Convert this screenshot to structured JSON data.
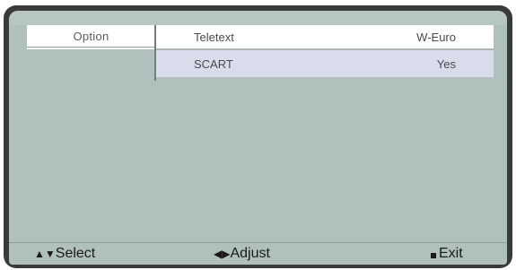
{
  "menu": {
    "category": "Option",
    "items": [
      {
        "label": "Teletext",
        "value": "W-Euro"
      },
      {
        "label": "SCART",
        "value": "Yes"
      }
    ]
  },
  "footer": {
    "select": {
      "icon": "up-down-arrows-icon",
      "glyph": "▲▼",
      "label": "Select"
    },
    "adjust": {
      "icon": "left-right-arrows-icon",
      "glyph": "◀▶",
      "label": "Adjust"
    },
    "exit": {
      "icon": "exit-square-icon",
      "label": "Exit"
    }
  },
  "colors": {
    "panel": "#b0c1bd",
    "row_normal": "#ffffff",
    "row_selected": "#d9dcea",
    "bezel": "#3a3a3a"
  }
}
